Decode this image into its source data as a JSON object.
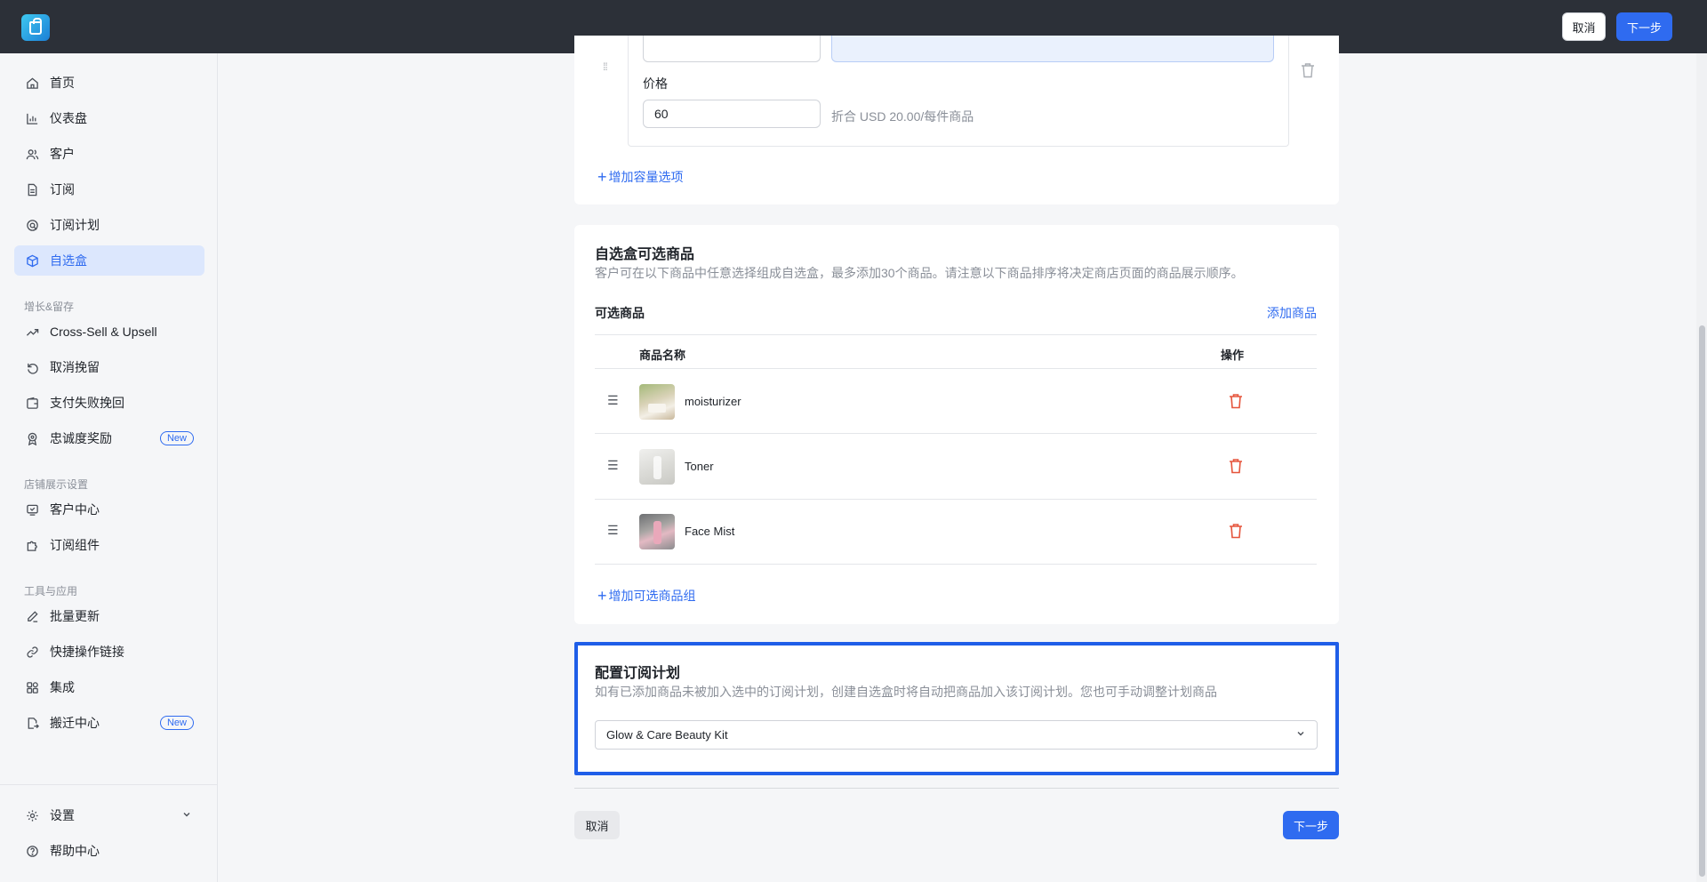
{
  "topbar": {
    "cancel_label": "取消",
    "next_label": "下一步"
  },
  "sidebar": {
    "items": [
      {
        "label": "首页",
        "icon": "home-icon"
      },
      {
        "label": "仪表盘",
        "icon": "bar-chart-icon"
      },
      {
        "label": "客户",
        "icon": "users-icon"
      },
      {
        "label": "订阅",
        "icon": "document-icon"
      },
      {
        "label": "订阅计划",
        "icon": "plan-icon"
      },
      {
        "label": "自选盒",
        "icon": "box-icon",
        "active": true
      }
    ],
    "section_growth": "增长&留存",
    "growth_items": [
      {
        "label": "Cross-Sell & Upsell",
        "icon": "trend-up-icon"
      },
      {
        "label": "取消挽留",
        "icon": "undo-icon"
      },
      {
        "label": "支付失败挽回",
        "icon": "wallet-icon"
      },
      {
        "label": "忠诚度奖励",
        "icon": "award-icon",
        "badge": "New"
      }
    ],
    "section_store": "店铺展示设置",
    "store_items": [
      {
        "label": "客户中心",
        "icon": "portal-icon"
      },
      {
        "label": "订阅组件",
        "icon": "puzzle-icon"
      }
    ],
    "section_tools": "工具与应用",
    "tools_items": [
      {
        "label": "批量更新",
        "icon": "pencil-icon"
      },
      {
        "label": "快捷操作链接",
        "icon": "link-icon"
      },
      {
        "label": "集成",
        "icon": "grid-icon"
      },
      {
        "label": "搬迁中心",
        "icon": "migrate-icon",
        "badge": "New"
      }
    ],
    "bottom_items": [
      {
        "label": "设置",
        "icon": "gear-icon"
      },
      {
        "label": "帮助中心",
        "icon": "help-icon"
      }
    ]
  },
  "capacity": {
    "price_label": "价格",
    "price_value": "60",
    "price_hint": "折合 USD 20.00/每件商品",
    "add_option_label": "增加容量选项"
  },
  "products": {
    "title": "自选盒可选商品",
    "description": "客户可在以下商品中任意选择组成自选盒，最多添加30个商品。请注意以下商品排序将决定商店页面的商品展示顺序。",
    "subheading": "可选商品",
    "add_product_label": "添加商品",
    "columns": [
      "商品名称",
      "操作"
    ],
    "rows": [
      {
        "name": "moisturizer"
      },
      {
        "name": "Toner"
      },
      {
        "name": "Face Mist"
      }
    ],
    "add_group_label": "增加可选商品组"
  },
  "plan": {
    "title": "配置订阅计划",
    "description": "如有已添加商品未被加入选中的订阅计划，创建自选盒时将自动把商品加入该订阅计划。您也可手动调整计划商品",
    "selected": "Glow & Care Beauty Kit"
  },
  "footer": {
    "cancel_label": "取消",
    "next_label": "下一步"
  },
  "colors": {
    "accent": "#2f6bf0",
    "topbar": "#2c3038",
    "danger": "#e5543b",
    "highlight": "#1f5ee8"
  }
}
